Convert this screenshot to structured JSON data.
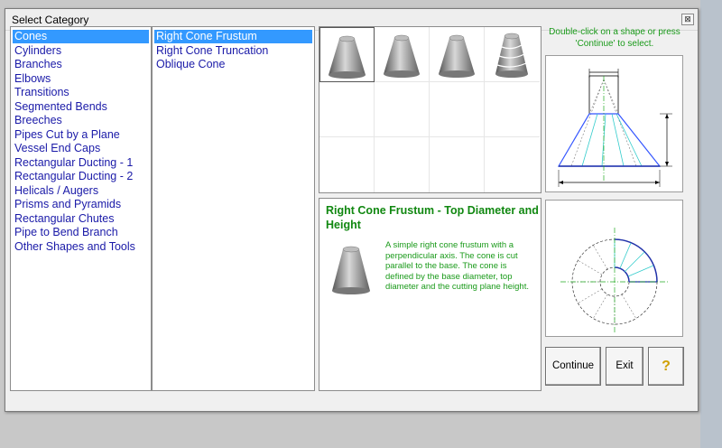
{
  "window": {
    "title": "Select Category",
    "close_glyph": "⊠"
  },
  "categories": [
    {
      "label": "Cones",
      "selected": true
    },
    {
      "label": "Cylinders"
    },
    {
      "label": "Branches"
    },
    {
      "label": "Elbows"
    },
    {
      "label": "Transitions"
    },
    {
      "label": "Segmented Bends"
    },
    {
      "label": "Breeches"
    },
    {
      "label": "Pipes Cut by a Plane"
    },
    {
      "label": "Vessel End Caps"
    },
    {
      "label": "Rectangular Ducting - 1"
    },
    {
      "label": "Rectangular Ducting - 2"
    },
    {
      "label": "Helicals / Augers"
    },
    {
      "label": "Prisms and Pyramids"
    },
    {
      "label": "Rectangular Chutes"
    },
    {
      "label": "Pipe to Bend Branch"
    },
    {
      "label": "Other Shapes and Tools"
    }
  ],
  "subcategories": [
    {
      "label": "Right Cone Frustum",
      "selected": true
    },
    {
      "label": "Right Cone Truncation"
    },
    {
      "label": "Oblique Cone"
    }
  ],
  "description": {
    "title": "Right Cone Frustum - Top Diameter and Height",
    "text": "A simple right cone frustum with a perpendicular axis. The cone is cut parallel to the base. The cone is defined by the base diameter, top diameter and the cutting plane height."
  },
  "hint": "Double-click on a shape or press 'Continue' to select.",
  "buttons": {
    "continue": "Continue",
    "exit": "Exit",
    "help": "?"
  },
  "icons": {
    "help": "question-mark-icon",
    "close": "close-icon"
  },
  "colors": {
    "selection": "#3399ff",
    "list_text": "#1a1aa8",
    "green_text": "#118811"
  }
}
